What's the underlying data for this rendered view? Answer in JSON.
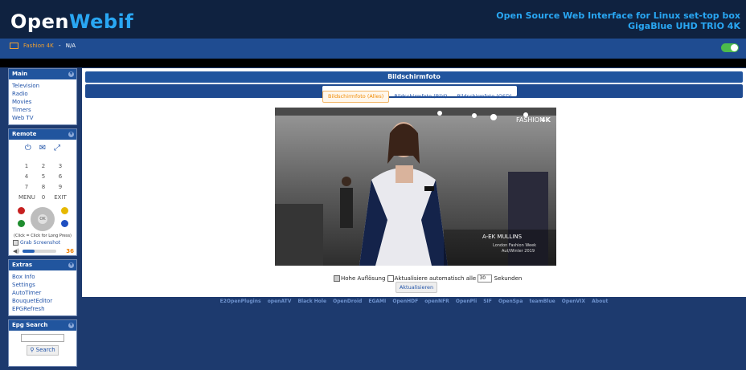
{
  "header": {
    "logo_left": "Open",
    "logo_right": "Webif",
    "tagline": "Open Source Web Interface for Linux set-top box",
    "device": "GigaBlue UHD TRIO 4K"
  },
  "status": {
    "channel": "Fashion 4K",
    "separator": "-",
    "now_playing": "N/A"
  },
  "sidebar": {
    "main": {
      "title": "Main",
      "items": [
        "Television",
        "Radio",
        "Movies",
        "Timers",
        "Web TV"
      ]
    },
    "remote": {
      "title": "Remote",
      "keys": [
        "1",
        "2",
        "3",
        "4",
        "5",
        "6",
        "7",
        "8",
        "9",
        "MENU",
        "0",
        "EXIT"
      ],
      "dpad_center": "OK",
      "hint": "(Click = Click for Long Press)",
      "grab_label": "Grab Screenshot",
      "volume": "36",
      "volume_fraction": 0.36
    },
    "extras": {
      "title": "Extras",
      "items": [
        "Box Info",
        "Settings",
        "AutoTimer",
        "BouquetEditor",
        "EPGRefresh"
      ]
    },
    "epg": {
      "title": "Epg Search",
      "button": "Search"
    }
  },
  "content": {
    "title": "Bildschirmfoto",
    "tabs": [
      "Bildschirmfoto (Alles)",
      "Bildschirmfoto (Bild)",
      "Bildschirmfoto (OSD)"
    ],
    "active_tab": 0,
    "overlay": {
      "channel_logo_a": "FASHION",
      "channel_logo_b": "4K",
      "designer": "A-EK MULLINS",
      "event": "London Fashion Week",
      "season": "Aut/Winter 2019"
    },
    "options": {
      "high_res_label": "Hohe Auflösung",
      "high_res_checked": true,
      "auto_label": "Aktualisiere automatisch alle",
      "auto_checked": false,
      "interval": "30",
      "unit": "Sekunden",
      "refresh_button": "Aktualisieren"
    }
  },
  "footer": {
    "links": [
      "E2OpenPlugins",
      "openATV",
      "Black Hole",
      "OpenDroid",
      "EGAMI",
      "OpenHDF",
      "openNFR",
      "OpenPli",
      "SIF",
      "OpenSpa",
      "teamBlue",
      "OpenVIX",
      "About"
    ]
  },
  "colors": {
    "header_bg": "#0f2240",
    "accent_blue": "#29a7f3",
    "bar_blue": "#21559e",
    "page_bg": "#1d3a6e",
    "orange": "#f08a00"
  }
}
